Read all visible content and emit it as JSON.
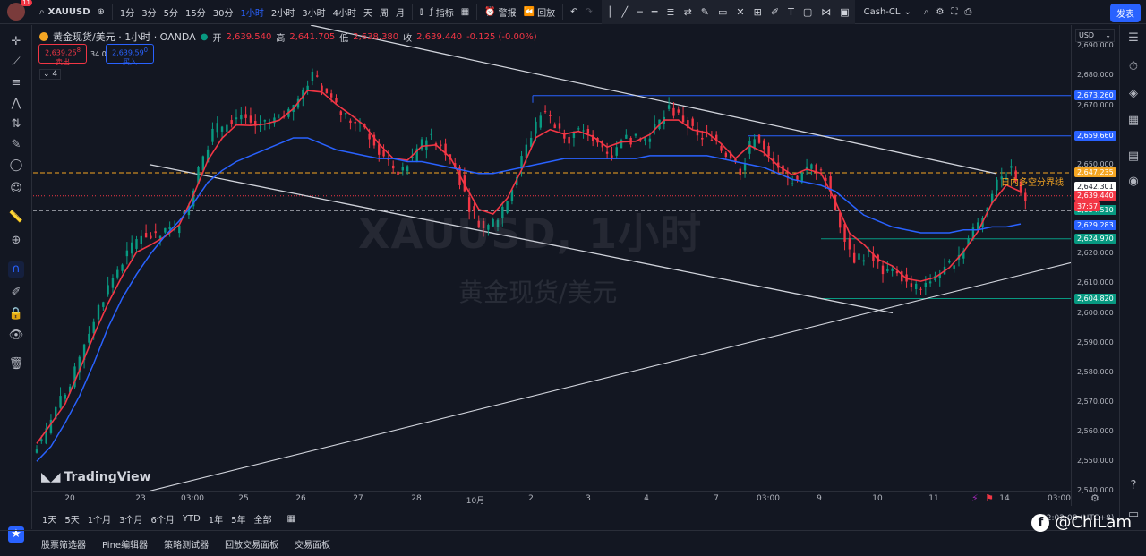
{
  "topbar": {
    "notifications": "11",
    "symbol": "XAUUSD",
    "timeframes": [
      "1分",
      "3分",
      "5分",
      "15分",
      "30分",
      "1小时",
      "2小时",
      "3小时",
      "4小时",
      "天",
      "周",
      "月"
    ],
    "active_timeframe": "1小时",
    "indicators_label": "指标",
    "alert_label": "警报",
    "replay_label": "回放",
    "layout_name": "Cash-CL",
    "publish_label": "发表"
  },
  "legend": {
    "title": "黄金现货/美元 · 1小时 · OANDA",
    "open_label": "开",
    "open": "2,639.540",
    "high_label": "高",
    "high": "2,641.705",
    "low_label": "低",
    "low": "2,638.380",
    "close_label": "收",
    "close": "2,639.440",
    "change": "-0.125 (-0.00%)",
    "sell_price": "2,639.25",
    "sell_sup": "8",
    "sell_label": "卖出",
    "spread": "34.0",
    "buy_price": "2,639.59",
    "buy_sup": "0",
    "buy_label": "买入",
    "indicator_count": "4"
  },
  "watermark": {
    "line1": "XAUUSD, 1小时",
    "line2": "黄金现货/美元"
  },
  "logo": "TradingView",
  "annotation": "日内多空分界线",
  "price_axis": {
    "currency": "USD",
    "ticks": [
      "2,690.000",
      "2,680.000",
      "2,670.000",
      "2,660.000",
      "2,650.000",
      "2,640.000",
      "2,630.000",
      "2,620.000",
      "2,610.000",
      "2,600.000",
      "2,590.000",
      "2,580.000",
      "2,570.000",
      "2,560.000",
      "2,550.000",
      "2,540.000"
    ],
    "tags": {
      "t1": "2,673.260",
      "t2": "2,659.660",
      "t3": "2,647.235",
      "t4": "2,642.301",
      "t5": "2,639.440",
      "t5b": "37:57",
      "t6": "2,634.510",
      "t7": "2,629.283",
      "t8": "2,624.970",
      "t9": "2,604.820"
    }
  },
  "time_axis": [
    "20",
    "23",
    "03:00",
    "25",
    "26",
    "27",
    "28",
    "10月",
    "2",
    "3",
    "4",
    "7",
    "03:00",
    "9",
    "10",
    "11",
    "14",
    "03:00"
  ],
  "range_bar": [
    "1天",
    "5天",
    "1个月",
    "3个月",
    "6个月",
    "YTD",
    "1年",
    "5年",
    "全部"
  ],
  "bottom_panel": [
    "股票筛选器",
    "Pine编辑器",
    "策略测试器",
    "回放交易面板",
    "交易面板"
  ],
  "timezone": "12:02:08 (UTC+8)",
  "corner_watermark": "@ChiLam",
  "chart_data": {
    "type": "candlestick",
    "title": "XAUUSD, 1小时",
    "ylim": [
      2535,
      2697
    ],
    "levels": [
      2673.26,
      2659.66,
      2647.235,
      2629.283,
      2624.97,
      2604.82
    ],
    "close_points": [
      2556,
      2568,
      2575,
      2590,
      2602,
      2612,
      2620,
      2627,
      2625,
      2628,
      2633,
      2648,
      2661,
      2665,
      2667,
      2663,
      2664,
      2666,
      2672,
      2680,
      2674,
      2667,
      2664,
      2660,
      2652,
      2648,
      2651,
      2660,
      2657,
      2649,
      2636,
      2628,
      2632,
      2643,
      2656,
      2668,
      2664,
      2659,
      2662,
      2658,
      2653,
      2659,
      2658,
      2662,
      2669,
      2665,
      2659,
      2660,
      2654,
      2648,
      2660,
      2652,
      2646,
      2644,
      2650,
      2646,
      2630,
      2618,
      2620,
      2614,
      2614,
      2608,
      2610,
      2613,
      2618,
      2625,
      2633,
      2645,
      2648,
      2639
    ],
    "ma_points": [
      2550,
      2555,
      2563,
      2572,
      2583,
      2595,
      2605,
      2613,
      2620,
      2626,
      2631,
      2637,
      2644,
      2648,
      2651,
      2653,
      2655,
      2657,
      2659,
      2659,
      2657,
      2655,
      2654,
      2653,
      2652,
      2652,
      2651,
      2651,
      2650,
      2649,
      2648,
      2647,
      2647,
      2648,
      2649,
      2650,
      2651,
      2652,
      2652,
      2652,
      2652,
      2652,
      2652,
      2653,
      2653,
      2653,
      2653,
      2653,
      2652,
      2651,
      2650,
      2649,
      2647,
      2645,
      2644,
      2643,
      2641,
      2637,
      2633,
      2631,
      2629,
      2628,
      2627,
      2627,
      2627,
      2628,
      2628,
      2629,
      2629,
      2630
    ]
  }
}
